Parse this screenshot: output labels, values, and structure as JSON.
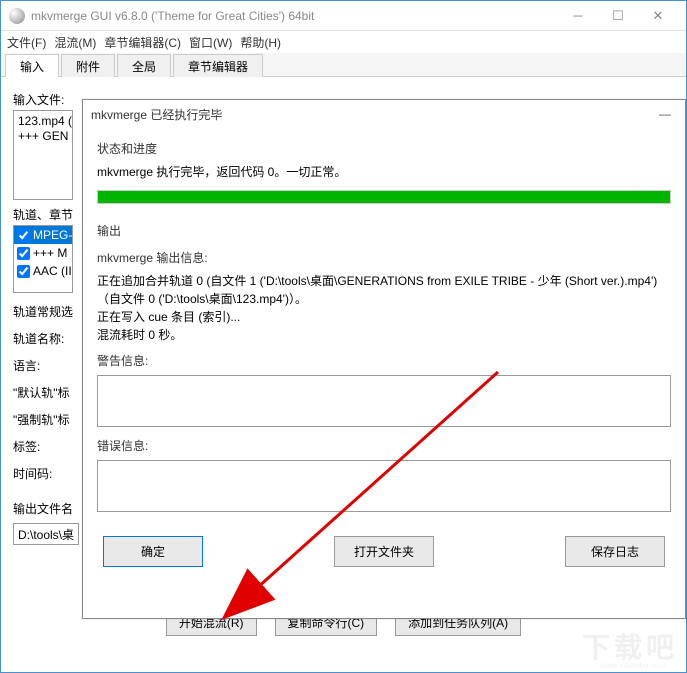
{
  "title": "mkvmerge GUI v6.8.0 ('Theme for Great Cities') 64bit",
  "menu": {
    "file": "文件(F)",
    "mux": "混流(M)",
    "chapter": "章节编辑器(C)",
    "window": "窗口(W)",
    "help": "帮助(H)"
  },
  "tabs": {
    "input": "输入",
    "attach": "附件",
    "global": "全局",
    "chapter": "章节编辑器"
  },
  "labels": {
    "input_files": "输入文件:",
    "tracks": "轨道、章节",
    "track_general": "轨道常规选",
    "track_name": "轨道名称:",
    "language": "语言:",
    "default_track": "\"默认轨\"标",
    "forced_track": "\"强制轨\"标",
    "tags": "标签:",
    "timecode": "时间码:",
    "output_filename": "输出文件名"
  },
  "files": {
    "line1": "123.mp4 (",
    "line2": "+++ GEN"
  },
  "tracks_items": [
    {
      "label": "MPEG-",
      "selected": true
    },
    {
      "label": "+++ M",
      "selected": false
    },
    {
      "label": "AAC (II",
      "selected": false
    }
  ],
  "output_file": "D:\\tools\\桌",
  "buttons": {
    "start": "开始混流(R)",
    "copy": "复制命令行(C)",
    "queue": "添加到任务队列(A)"
  },
  "dialog": {
    "title": "mkvmerge 已经执行完毕",
    "section_status": "状态和进度",
    "status_line": "mkvmerge 执行完毕，返回代码 0。一切正常。",
    "section_output": "输出",
    "output_title": "mkvmerge 输出信息:",
    "out1": "正在追加合并轨道 0 (自文件 1 ('D:\\tools\\桌面\\GENERATIONS from EXILE TRIBE - 少年 (Short ver.).mp4')",
    "out2": "（自文件 0 ('D:\\tools\\桌面\\123.mp4')）。",
    "out3": "正在写入 cue 条目 (索引)...",
    "out4": "混流耗时 0 秒。",
    "warning_label": "警告信息:",
    "error_label": "错误信息:",
    "ok": "确定",
    "open_folder": "打开文件夹",
    "save_log": "保存日志"
  },
  "watermark": "下载吧",
  "watermark_sub": "www.xiazaiba.com"
}
